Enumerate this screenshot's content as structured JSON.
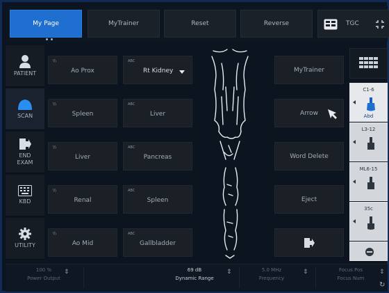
{
  "top_tabs": [
    {
      "label": "My Page"
    },
    {
      "label": "MyTrainer"
    },
    {
      "label": "Reset"
    },
    {
      "label": "Reverse"
    }
  ],
  "tgc": {
    "label": "TGC"
  },
  "sidebar": {
    "items": [
      {
        "label": "PATIENT",
        "icon": "person-icon"
      },
      {
        "label": "SCAN",
        "icon": "scan-icon"
      },
      {
        "label": "END\nEXAM",
        "icon": "exit-icon"
      },
      {
        "label": "KBD",
        "icon": "keyboard-icon"
      },
      {
        "label": "UTILITY",
        "icon": "gear-icon"
      }
    ]
  },
  "presets": [
    {
      "tag": "\\\\\\",
      "label": "Ao Prox"
    },
    {
      "tag": "ABC",
      "label": "Rt Kidney"
    },
    {
      "tag": "\\\\\\",
      "label": "Spleen"
    },
    {
      "tag": "ABC",
      "label": "Liver"
    },
    {
      "tag": "\\\\\\",
      "label": "Liver"
    },
    {
      "tag": "ABC",
      "label": "Pancreas"
    },
    {
      "tag": "\\\\\\",
      "label": "Renal"
    },
    {
      "tag": "ABC",
      "label": "Spleen"
    },
    {
      "tag": "\\\\\\",
      "label": "Ao Mid"
    },
    {
      "tag": "ABC",
      "label": "Gallbladder"
    }
  ],
  "right_buttons": [
    {
      "label": "MyTrainer"
    },
    {
      "label": "Arrow"
    },
    {
      "label": "Word Delete"
    },
    {
      "label": "Eject"
    }
  ],
  "probes": [
    {
      "name": "C1-6",
      "sub": "Abd"
    },
    {
      "name": "L3-12",
      "sub": ""
    },
    {
      "name": "ML6-15",
      "sub": ""
    },
    {
      "name": "35c",
      "sub": ""
    }
  ],
  "bottom": {
    "acoustic_output": {
      "value": "100 %",
      "label": "Power Output"
    },
    "dynamic_range": {
      "value": "69 dB",
      "label": "Dynamic Range"
    },
    "frequency": {
      "value": "5.0 MHz",
      "label": "Frequency"
    },
    "focus": {
      "value": "Focus Pos",
      "label": "Focus Num"
    }
  },
  "colors": {
    "accent": "#1f6fd0",
    "background": "#0c1420",
    "probe_bg": "#d3d6da"
  }
}
